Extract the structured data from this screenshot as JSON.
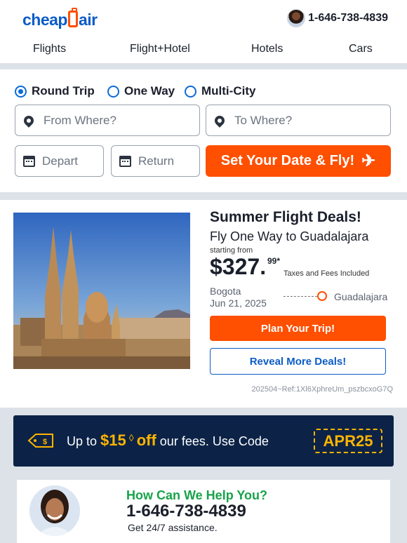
{
  "header": {
    "logo_text": [
      "cheap",
      "air"
    ],
    "phone": "1-646-738-4839",
    "nav": [
      "Flights",
      "Flight+Hotel",
      "Hotels",
      "Cars"
    ]
  },
  "search": {
    "trip_types": [
      {
        "label": "Round Trip",
        "selected": true
      },
      {
        "label": "One Way",
        "selected": false
      },
      {
        "label": "Multi-City",
        "selected": false
      }
    ],
    "from_placeholder": "From Where?",
    "to_placeholder": "To Where?",
    "depart_placeholder": "Depart",
    "return_placeholder": "Return",
    "cta_label": "Set Your Date & Fly!"
  },
  "deal": {
    "title": "Summer Flight Deals!",
    "subtitle": "Fly One Way to Guadalajara",
    "starting_from": "starting from",
    "price": "$327.",
    "cents": "99*",
    "taxes_note": "Taxes and Fees Included",
    "origin": "Bogota",
    "date": "Jun 21, 2025",
    "destination": "Guadalajara",
    "plan_button": "Plan Your Trip!",
    "reveal_button": "Reveal More Deals!",
    "ref_code": "202504~Ref:1Xl6XphreUm_pszbcxoG7Q"
  },
  "promo": {
    "prefix": "Up to",
    "amount": "$15",
    "diamond": "◊",
    "off": "off",
    "suffix": "our fees. Use Code",
    "code": "APR25"
  },
  "help": {
    "title": "How Can We Help You?",
    "phone": "1-646-738-4839",
    "subtitle": "Get 24/7 assistance."
  },
  "colors": {
    "brand_blue": "#0b5cc7",
    "brand_orange": "#ff4f00",
    "promo_navy": "#0c2347",
    "promo_gold": "#ffb400",
    "help_green": "#18a34a"
  }
}
